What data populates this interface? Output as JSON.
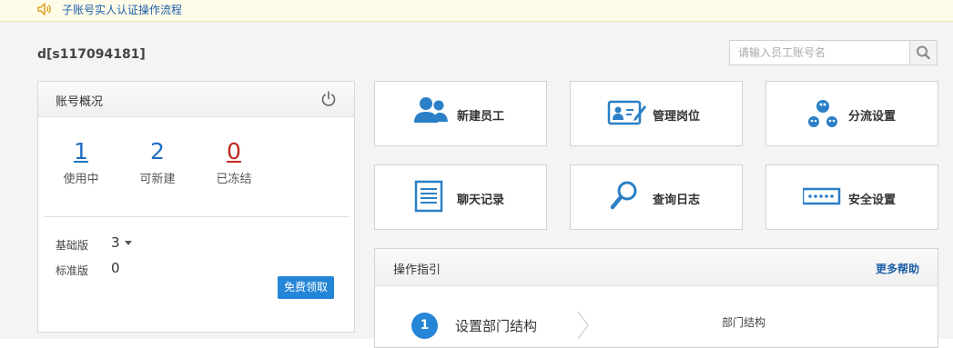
{
  "notice": {
    "text": "子账号实人认证操作流程",
    "icon": "speaker-icon"
  },
  "account": {
    "name": "d[s117094181]"
  },
  "search": {
    "placeholder": "请输入员工账号名",
    "value": "",
    "icon": "search-icon"
  },
  "overview": {
    "title": "账号概况",
    "stats": [
      {
        "value": "1",
        "label": "使用中",
        "color": "#1e6fc2"
      },
      {
        "value": "2",
        "label": "可新建",
        "color": "#1e6fc2"
      },
      {
        "value": "0",
        "label": "已冻结",
        "color": "#c0281e"
      }
    ],
    "tiers": [
      {
        "label": "基础版",
        "value": "3"
      },
      {
        "label": "标准版",
        "value": "0"
      }
    ],
    "free_button": "免费领取"
  },
  "tiles": [
    {
      "label": "新建员工",
      "icon": "add-employee-icon"
    },
    {
      "label": "管理岗位",
      "icon": "manage-position-icon"
    },
    {
      "label": "分流设置",
      "icon": "distribution-icon"
    },
    {
      "label": "聊天记录",
      "icon": "chat-log-icon"
    },
    {
      "label": "查询日志",
      "icon": "query-log-icon"
    },
    {
      "label": "安全设置",
      "icon": "password-icon"
    }
  ],
  "guide": {
    "title": "操作指引",
    "more": "更多帮助",
    "step_number": "1",
    "step_label": "设置部门结构",
    "right_label": "部门结构"
  },
  "colors": {
    "accent": "#2585d6",
    "icon_blue": "#2a7fc6",
    "link": "#1e5fa8",
    "frozen": "#c0281e"
  }
}
